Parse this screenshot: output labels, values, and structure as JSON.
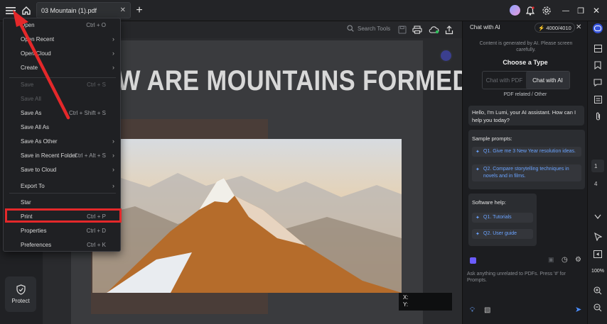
{
  "titlebar": {
    "tab_label": "03 Mountain (1).pdf",
    "tab_close": "✕",
    "new_tab": "+",
    "window_controls": [
      "—",
      "❐",
      "✕"
    ]
  },
  "toolbar": {
    "search_placeholder": "Search Tools"
  },
  "menu": {
    "items": [
      {
        "label": "Open",
        "shortcut": "Ctrl + O",
        "submenu": false,
        "disabled": false
      },
      {
        "label": "Open Recent",
        "shortcut": "",
        "submenu": true,
        "disabled": false
      },
      {
        "label": "Open Cloud",
        "shortcut": "",
        "submenu": true,
        "disabled": false
      },
      {
        "label": "Create",
        "shortcut": "",
        "submenu": true,
        "disabled": false
      },
      {
        "label": "Save",
        "shortcut": "Ctrl + S",
        "submenu": false,
        "disabled": true
      },
      {
        "label": "Save All",
        "shortcut": "",
        "submenu": false,
        "disabled": true
      },
      {
        "label": "Save As",
        "shortcut": "Ctrl + Shift + S",
        "submenu": false,
        "disabled": false
      },
      {
        "label": "Save All As",
        "shortcut": "",
        "submenu": false,
        "disabled": false
      },
      {
        "label": "Save As Other",
        "shortcut": "",
        "submenu": true,
        "disabled": false
      },
      {
        "label": "Save in Recent Folder",
        "shortcut": "Ctrl + Alt + S",
        "submenu": true,
        "disabled": false
      },
      {
        "label": "Save to Cloud",
        "shortcut": "",
        "submenu": true,
        "disabled": false
      },
      {
        "label": "Export To",
        "shortcut": "",
        "submenu": true,
        "disabled": false
      },
      {
        "label": "Star",
        "shortcut": "",
        "submenu": false,
        "disabled": false
      },
      {
        "label": "Print",
        "shortcut": "Ctrl + P",
        "submenu": false,
        "disabled": false
      },
      {
        "label": "Properties",
        "shortcut": "Ctrl + D",
        "submenu": false,
        "disabled": false
      },
      {
        "label": "Preferences",
        "shortcut": "Ctrl + K",
        "submenu": false,
        "disabled": false
      }
    ]
  },
  "leftrail": {
    "protect_label": "Protect",
    "more": "•••"
  },
  "document": {
    "title": "W ARE MOUNTAINS FORMED?",
    "coord_x": "X:",
    "coord_y": "Y:"
  },
  "ai": {
    "header": "Chat with AI",
    "credits": "4000/4010",
    "close": "✕",
    "note": "Content is generated by AI. Please screen carefully.",
    "choose_type": "Choose a Type",
    "type_pdf": "Chat with PDF",
    "type_ai": "Chat with AI",
    "sub": "PDF related / Other",
    "hello": "Hello, I'm Lumi, your AI assistant. How can I help you today?",
    "sample_title": "Sample prompts:",
    "sample_1": "Q1. Give me 3 New Year resolution ideas.",
    "sample_2": "Q2. Compare storytelling techniques in novels and in films.",
    "software_title": "Software help:",
    "soft_1": "Q1. Tutorials",
    "soft_2": "Q2. User guide",
    "input_note": "Ask anything unrelated to PDFs. Press '#' for Prompts."
  },
  "rightrail": {
    "page_current": "1",
    "page_total": "4",
    "zoom": "100%"
  },
  "colors": {
    "highlight": "#e4282a",
    "link": "#6aa3ff",
    "background": "#1e1f22"
  }
}
